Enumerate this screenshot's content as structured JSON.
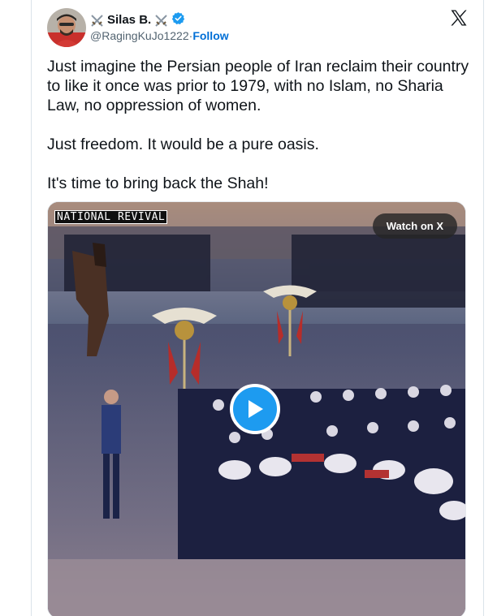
{
  "tweet": {
    "author_name": "Silas B.",
    "handle": "@RagingKuJo1222",
    "separator": " · ",
    "follow_label": "Follow",
    "verified": true,
    "paragraphs": [
      "Just imagine the Persian people of Iran reclaim their country to like it once was prior to 1979, with no Islam, no Sharia Law, no oppression of women.",
      "Just freedom. It would be a pure oasis.",
      "It's time to bring back the Shah!"
    ]
  },
  "media": {
    "caption": "NATIONAL REVIVAL",
    "watch_label": "Watch on X"
  },
  "colors": {
    "accent": "#1d9bf0",
    "follow": "#006fd6",
    "muted": "#536471"
  },
  "icons": [
    "crossed-swords-icon",
    "verified-badge-icon",
    "x-logo-icon",
    "play-icon"
  ]
}
